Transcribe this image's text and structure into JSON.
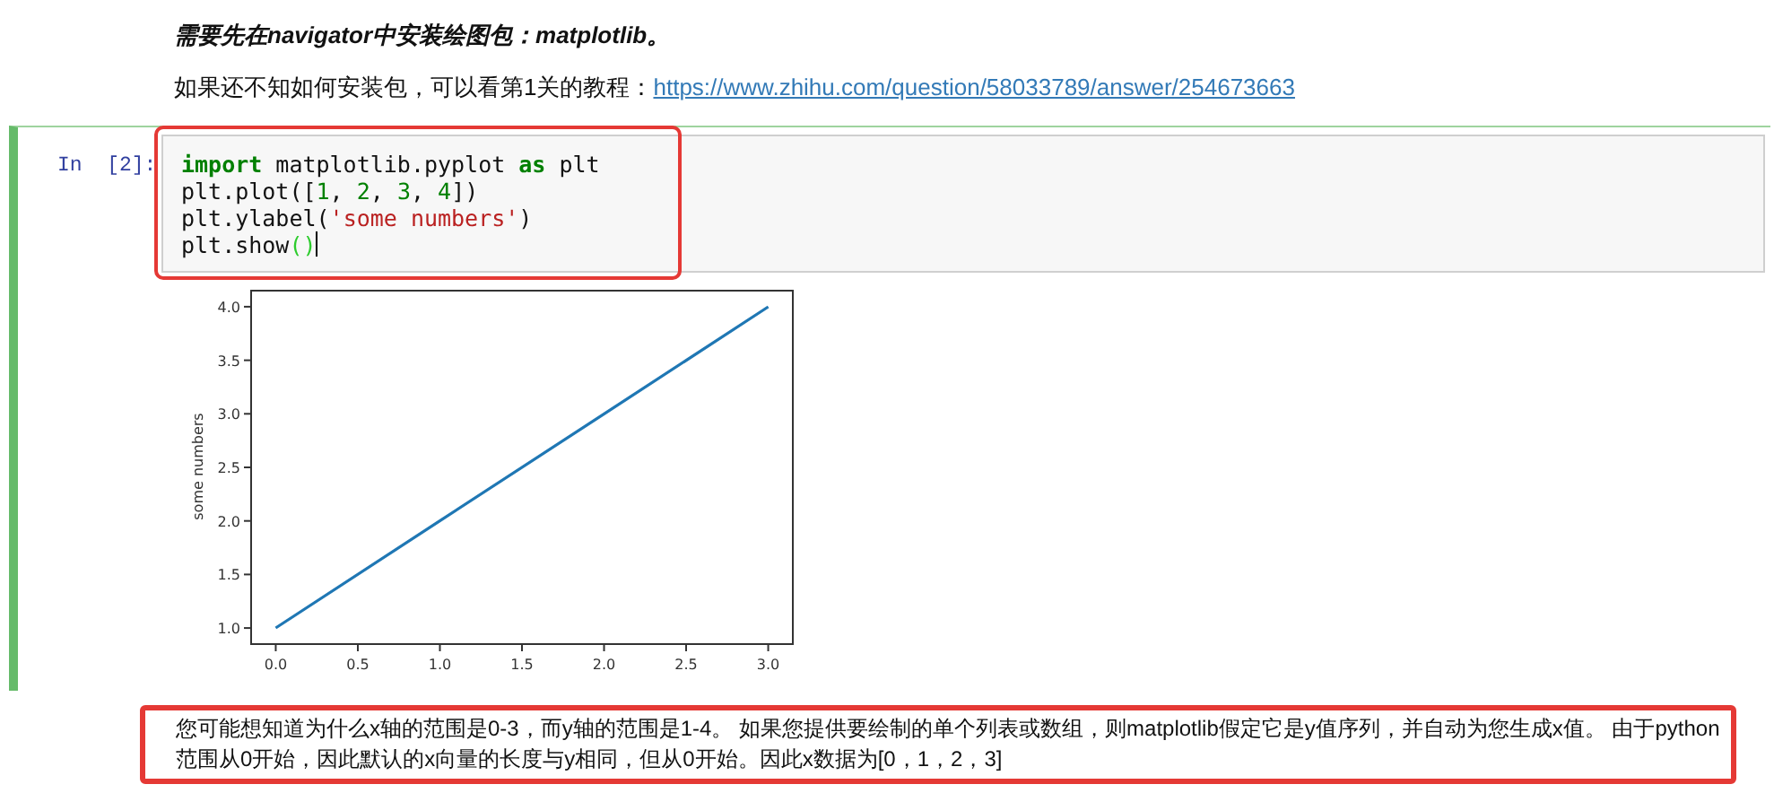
{
  "heading": "需要先在navigator中安装绘图包：matplotlib。",
  "intro": {
    "text": "如果还不知如何安装包，可以看第1关的教程：",
    "link": "https://www.zhihu.com/question/58033789/answer/254673663"
  },
  "cell": {
    "prompt": "In  [2]:",
    "selected": true,
    "code": [
      [
        {
          "t": "import",
          "kind": "keyword"
        },
        {
          "t": " matplotlib.pyplot ",
          "kind": "plain"
        },
        {
          "t": "as",
          "kind": "keyword"
        },
        {
          "t": " plt",
          "kind": "plain"
        }
      ],
      [
        {
          "t": "plt.plot([",
          "kind": "plain"
        },
        {
          "t": "1",
          "kind": "number"
        },
        {
          "t": ", ",
          "kind": "plain"
        },
        {
          "t": "2",
          "kind": "number"
        },
        {
          "t": ", ",
          "kind": "plain"
        },
        {
          "t": "3",
          "kind": "number"
        },
        {
          "t": ", ",
          "kind": "plain"
        },
        {
          "t": "4",
          "kind": "number"
        },
        {
          "t": "])",
          "kind": "plain"
        }
      ],
      [
        {
          "t": "plt.ylabel(",
          "kind": "plain"
        },
        {
          "t": "'some numbers'",
          "kind": "string"
        },
        {
          "t": ")",
          "kind": "plain"
        }
      ],
      [
        {
          "t": "plt.show",
          "kind": "plain"
        },
        {
          "t": "()",
          "kind": "paren"
        }
      ]
    ],
    "output": {
      "chart_data": {
        "type": "line",
        "ylabel": "some numbers",
        "x": [
          0,
          1,
          2,
          3
        ],
        "values": [
          1,
          2,
          3,
          4
        ],
        "xlim": [
          -0.15,
          3.15
        ],
        "ylim": [
          0.85,
          4.15
        ],
        "xticks": [
          {
            "value": 0,
            "label": "0.0"
          },
          {
            "value": 0.5,
            "label": "0.5"
          },
          {
            "value": 1,
            "label": "1.0"
          },
          {
            "value": 1.5,
            "label": "1.5"
          },
          {
            "value": 2,
            "label": "2.0"
          },
          {
            "value": 2.5,
            "label": "2.5"
          },
          {
            "value": 3,
            "label": "3.0"
          }
        ],
        "yticks": [
          {
            "value": 1,
            "label": "1.0"
          },
          {
            "value": 1.5,
            "label": "1.5"
          },
          {
            "value": 2,
            "label": "2.0"
          },
          {
            "value": 2.5,
            "label": "2.5"
          },
          {
            "value": 3,
            "label": "3.0"
          },
          {
            "value": 3.5,
            "label": "3.5"
          },
          {
            "value": 4,
            "label": "4.0"
          }
        ]
      }
    }
  },
  "note": "您可能想知道为什么x轴的范围是0-3，而y轴的范围是1-4。 如果您提供要绘制的单个列表或数组，则matplotlib假定它是y值序列，并自动为您生成x值。 由于python范围从0开始，因此默认的x向量的长度与y相同，但从0开始。因此x数据为[0，1，2，3]"
}
